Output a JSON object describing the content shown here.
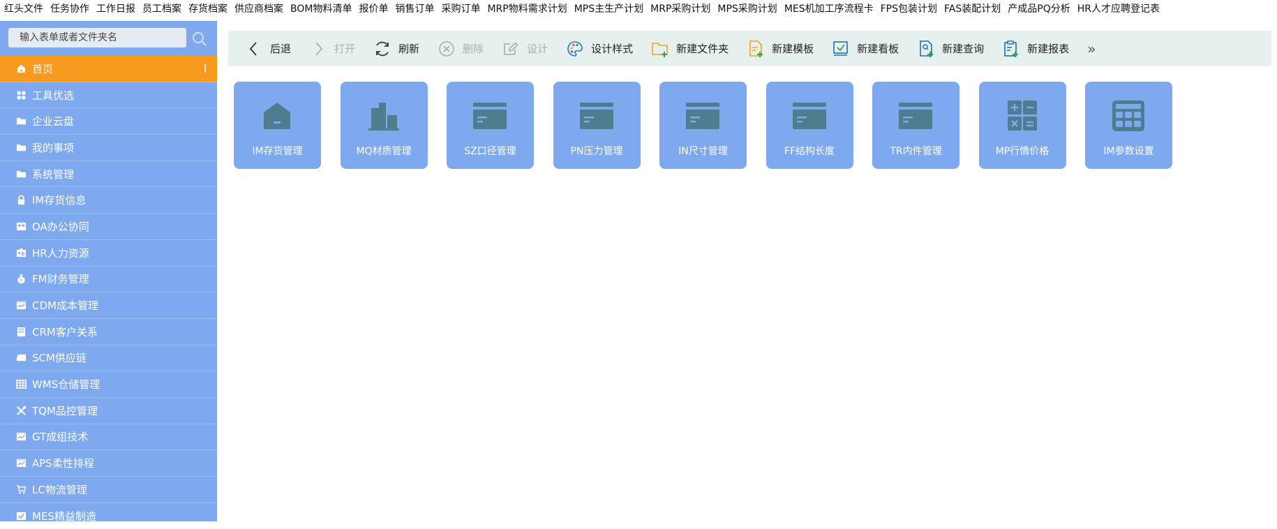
{
  "top_menu": [
    "红头文件",
    "任务协作",
    "工作日报",
    "员工档案",
    "存货档案",
    "供应商档案",
    "BOM物料清单",
    "报价单",
    "销售订单",
    "采购订单",
    "MRP物料需求计划",
    "MPS主生产计划",
    "MRP采购计划",
    "MPS采购计划",
    "MES机加工序流程卡",
    "FPS包装计划",
    "FAS装配计划",
    "产成品PQ分析",
    "HR人才应聘登记表"
  ],
  "search": {
    "placeholder": "输入表单或者文件夹名"
  },
  "sidebar": {
    "items": [
      {
        "label": "首页",
        "icon": "home-icon",
        "active": true
      },
      {
        "label": "工具优选",
        "icon": "apps-icon"
      },
      {
        "label": "企业云盘",
        "icon": "folder-icon"
      },
      {
        "label": "我的事项",
        "icon": "folder-icon"
      },
      {
        "label": "系统管理",
        "icon": "folder-icon"
      },
      {
        "label": "IM存货信息",
        "icon": "lock-icon"
      },
      {
        "label": "OA办公协同",
        "icon": "office-icon"
      },
      {
        "label": "HR人力资源",
        "icon": "id-card-icon"
      },
      {
        "label": "FM财务管理",
        "icon": "money-bag-icon"
      },
      {
        "label": "CDM成本管理",
        "icon": "chart-card-icon"
      },
      {
        "label": "CRM客户关系",
        "icon": "building-icon"
      },
      {
        "label": "SCM供应链",
        "icon": "truck-icon"
      },
      {
        "label": "WMS仓储管理",
        "icon": "grid-table-icon"
      },
      {
        "label": "TQM品控管理",
        "icon": "tools-icon"
      },
      {
        "label": "GT成组技术",
        "icon": "chart-card-icon"
      },
      {
        "label": "APS柔性排程",
        "icon": "chart-card-icon"
      },
      {
        "label": "LC物流管理",
        "icon": "cart-icon"
      },
      {
        "label": "MES精益制造",
        "icon": "check-card-icon"
      }
    ]
  },
  "toolbar": {
    "items": [
      {
        "label": "后退",
        "icon": "chevron-left-icon",
        "enabled": true
      },
      {
        "label": "打开",
        "icon": "chevron-right-icon",
        "enabled": false
      },
      {
        "label": "刷新",
        "icon": "refresh-icon",
        "enabled": true
      },
      {
        "label": "删除",
        "icon": "delete-circle-icon",
        "enabled": false
      },
      {
        "label": "设计",
        "icon": "edit-icon",
        "enabled": false
      },
      {
        "label": "设计样式",
        "icon": "palette-icon",
        "enabled": true
      },
      {
        "label": "新建文件夹",
        "icon": "folder-add-icon",
        "enabled": true
      },
      {
        "label": "新建模板",
        "icon": "template-add-icon",
        "enabled": true
      },
      {
        "label": "新建看板",
        "icon": "dashboard-add-icon",
        "enabled": true
      },
      {
        "label": "新建查询",
        "icon": "query-add-icon",
        "enabled": true
      },
      {
        "label": "新建报表",
        "icon": "report-add-icon",
        "enabled": true
      }
    ],
    "more": "»"
  },
  "tiles": [
    {
      "label": "IM存货管理",
      "icon": "house-icon"
    },
    {
      "label": "MQ材质管理",
      "icon": "buildings-icon"
    },
    {
      "label": "SZ口径管理",
      "icon": "card-icon"
    },
    {
      "label": "PN压力管理",
      "icon": "card-icon"
    },
    {
      "label": "IN尺寸管理",
      "icon": "card-icon"
    },
    {
      "label": "FF结构长度",
      "icon": "card-icon"
    },
    {
      "label": "TR内件管理",
      "icon": "card-icon"
    },
    {
      "label": "MP行情价格",
      "icon": "calculator-icon"
    },
    {
      "label": "IM参数设置",
      "icon": "keypad-icon"
    }
  ],
  "colors": {
    "sidebar_bg": "#7fa9ef",
    "sidebar_active": "#f79a1e",
    "toolbar_bg": "#e6f0ee",
    "tile_bg": "#7fa9ee",
    "tile_icon": "#4f7c8f"
  }
}
